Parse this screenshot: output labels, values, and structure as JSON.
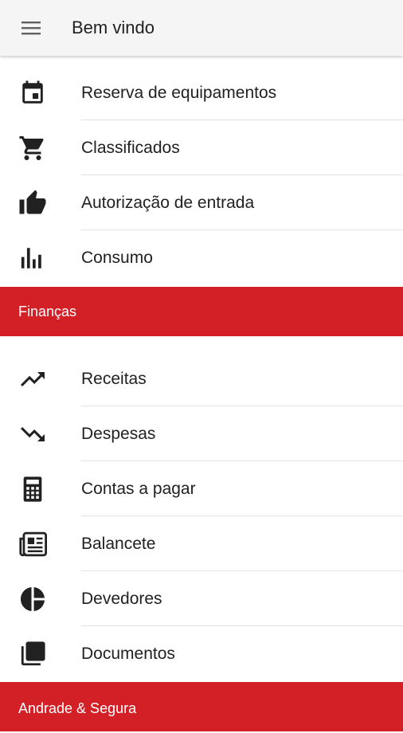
{
  "header": {
    "title": "Bem vindo",
    "menu_icon": "menu-icon"
  },
  "colors": {
    "accent": "#d32027",
    "appbar": "#f5f5f5",
    "divider": "#e3e3e3"
  },
  "group1": {
    "items": [
      {
        "label": "Reserva de equipamentos",
        "icon": "calendar-icon"
      },
      {
        "label": "Classificados",
        "icon": "cart-icon"
      },
      {
        "label": "Autorização de entrada",
        "icon": "thumb-up-icon"
      },
      {
        "label": "Consumo",
        "icon": "bar-chart-icon"
      }
    ]
  },
  "sections": [
    {
      "label": "Finanças"
    },
    {
      "label": "Andrade & Segura"
    }
  ],
  "group2": {
    "items": [
      {
        "label": "Receitas",
        "icon": "trending-up-icon"
      },
      {
        "label": "Despesas",
        "icon": "trending-down-icon"
      },
      {
        "label": "Contas a pagar",
        "icon": "calculator-icon"
      },
      {
        "label": "Balancete",
        "icon": "newspaper-icon"
      },
      {
        "label": "Devedores",
        "icon": "pie-chart-icon"
      },
      {
        "label": "Documentos",
        "icon": "documents-icon"
      }
    ]
  }
}
